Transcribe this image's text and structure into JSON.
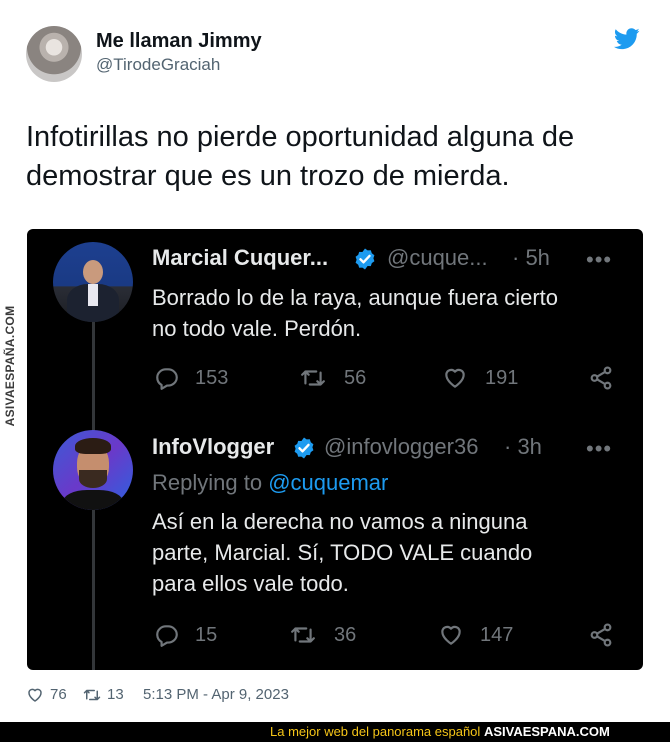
{
  "tweet": {
    "author_name": "Me llaman Jimmy",
    "author_handle": "@TirodeGraciah",
    "text": "Infotirillas no pierde oportunidad alguna de demostrar que es un trozo de mierda.",
    "likes": "76",
    "retweets": "13",
    "timestamp": "5:13 PM - Apr 9, 2023"
  },
  "embedded": {
    "post1": {
      "name": "Marcial Cuquer...",
      "handle": "@cuque...",
      "time": "· 5h",
      "more": "•••",
      "line1": "Borrado lo de la raya, aunque fuera cierto",
      "line2": "no todo vale. Perdón.",
      "replies": "153",
      "reposts": "56",
      "likes": "191"
    },
    "post2": {
      "name": "InfoVlogger",
      "handle": "@infovlogger36",
      "time": "· 3h",
      "more": "•••",
      "replying_prefix": "Replying to",
      "replying_to": "@cuquemar",
      "line1": "Así en la derecha no vamos a ninguna",
      "line2": "parte, Marcial. Sí, TODO VALE cuando",
      "line3": "para ellos vale todo.",
      "replies": "15",
      "reposts": "36",
      "likes": "147"
    }
  },
  "watermark": "ASIVAESPAÑA.COM",
  "banner": {
    "tagline": "La mejor web del panorama español",
    "brand": "ASIVAESPANA.COM"
  },
  "colors": {
    "twitter_blue": "#1d9bf0",
    "banner_yellow": "#f5c518"
  },
  "icons": [
    "twitter-bird-icon",
    "verified-badge-icon",
    "reply-icon",
    "repost-icon",
    "heart-icon",
    "share-icon",
    "more-icon"
  ]
}
